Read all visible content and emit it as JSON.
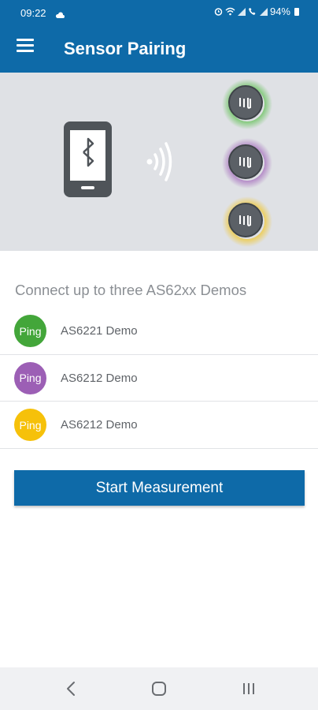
{
  "status_bar": {
    "time": "09:22",
    "battery": "94%",
    "icons": [
      "cloud-icon",
      "alarm-icon",
      "wifi-icon",
      "signal-icon",
      "call-icon",
      "signal-icon",
      "battery-icon"
    ]
  },
  "app_bar": {
    "title": "Sensor Pairing",
    "menu_icon": "hamburger-menu-icon"
  },
  "hero": {
    "phone_icon": "phone-bluetooth-icon",
    "signal_icon": "wireless-signal-icon",
    "sensor_colors": [
      "#4cbb3c",
      "#9b59b6",
      "#f4c20d"
    ]
  },
  "content": {
    "subtitle": "Connect up to three AS62xx Demos",
    "devices": [
      {
        "ping_label": "Ping",
        "name": "AS6221 Demo",
        "color": "#43a63a"
      },
      {
        "ping_label": "Ping",
        "name": "AS6212 Demo",
        "color": "#9c5fb5"
      },
      {
        "ping_label": "Ping",
        "name": "AS6212 Demo",
        "color": "#f6c10a"
      }
    ],
    "start_button": "Start Measurement"
  },
  "nav_bar": {
    "items": [
      "back-icon",
      "home-icon",
      "recents-icon"
    ]
  },
  "colors": {
    "primary": "#0e6aa8",
    "hero_bg": "#dfe1e5"
  }
}
